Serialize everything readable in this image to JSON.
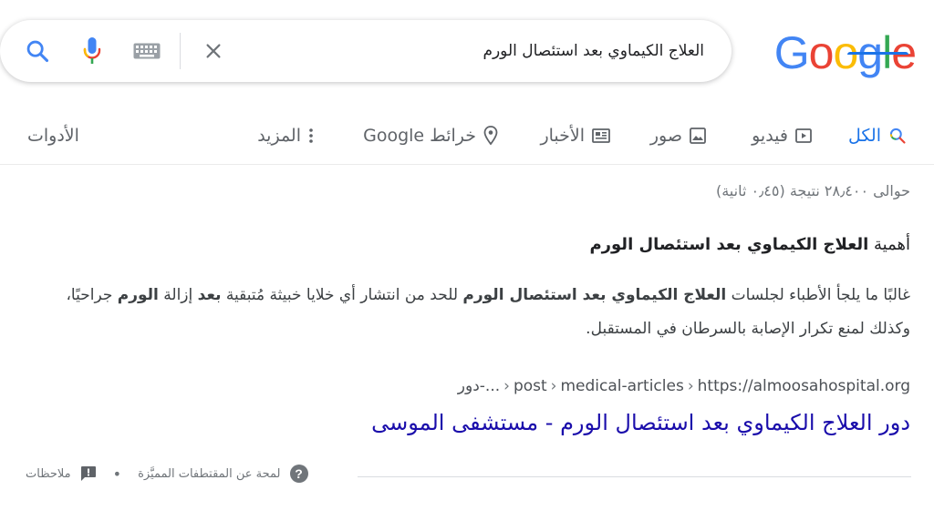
{
  "logo": {
    "text": "Google",
    "letters": [
      "G",
      "o",
      "o",
      "g",
      "l",
      "e"
    ],
    "colors": [
      "#4285f4",
      "#ea4335",
      "#fbbc05",
      "#4285f4",
      "#34a853",
      "#ea4335"
    ]
  },
  "search": {
    "query": "العلاج الكيماوي بعد استئصال الورم",
    "icons": [
      "clear-icon",
      "keyboard-icon",
      "mic-icon",
      "search-icon"
    ]
  },
  "tabs": {
    "all": "الكل",
    "video": "فيديو",
    "images": "صور",
    "news": "الأخبار",
    "maps": "خرائط Google",
    "more": "المزيد",
    "tools": "الأدوات"
  },
  "results": {
    "stats": "حوالى ٢٨٫٤٠٠ نتيجة (٠٫٤٥ ثانية)",
    "snippet_heading_prefix": "أهمية ",
    "snippet_heading_bold": "العلاج الكيماوي بعد استئصال الورم",
    "snippet_p1": "غالبًا ما يلجأ الأطباء لجلسات ",
    "snippet_b1": "العلاج الكيماوي بعد استئصال الورم",
    "snippet_p2": " للحد من انتشار أي خلايا خبيثة مُتبقية ",
    "snippet_b2": "بعد",
    "snippet_p3": " إزالة ",
    "snippet_b3": "الورم",
    "snippet_p4": " جراحيًا، وكذلك لمنع تكرار الإصابة بالسرطان في المستقبل.",
    "url_domain": "https://almoosahospital.org",
    "url_path1": "medical-articles",
    "url_path2": "post",
    "url_path3": "دور-...",
    "url_separator": "›",
    "title": "دور العلاج الكيماوي بعد استئصال الورم - مستشفى الموسى"
  },
  "footer": {
    "about_snippets": "لمحة عن المقتطفات المميَّزة",
    "feedback": "ملاحظات",
    "dot": "•",
    "help_glyph": "?"
  },
  "colors": {
    "link": "#1a0dab",
    "accent": "#1a73e8",
    "secondary_text": "#70757a"
  }
}
